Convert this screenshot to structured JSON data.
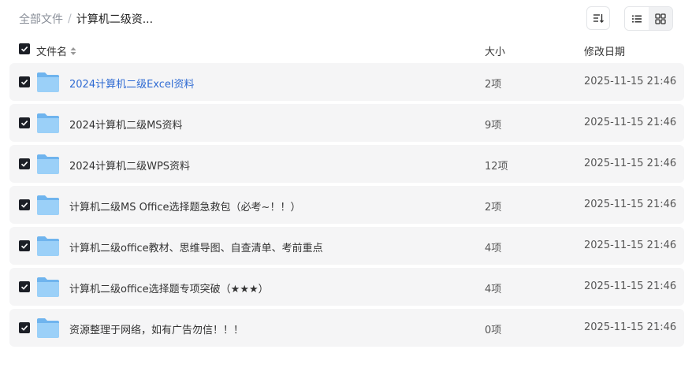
{
  "breadcrumb": {
    "root": "全部文件",
    "separator": "/",
    "current": "计算机二级资..."
  },
  "header": {
    "name": "文件名",
    "size": "大小",
    "date": "修改日期"
  },
  "icons": {
    "sort": "sort-icon",
    "list_view": "list-view-icon",
    "grid_view": "grid-view-icon",
    "folder": "folder-icon",
    "checkbox": "checked-checkbox-icon"
  },
  "colors": {
    "link": "#2f6bd3",
    "row_bg": "#f5f5f6",
    "checkbox": "#1c1f26",
    "folder": "#8cc8f6"
  },
  "files": [
    {
      "name": "2024计算机二级Excel资料",
      "size": "2项",
      "date": "2025-11-15 21:46"
    },
    {
      "name": "2024计算机二级MS资料",
      "size": "9项",
      "date": "2025-11-15 21:46"
    },
    {
      "name": "2024计算机二级WPS资料",
      "size": "12项",
      "date": "2025-11-15 21:46"
    },
    {
      "name": "计算机二级MS Office选择题急救包（必考~！！）",
      "size": "2项",
      "date": "2025-11-15 21:46"
    },
    {
      "name": "计算机二级office教材、思维导图、自查清单、考前重点",
      "size": "4项",
      "date": "2025-11-15 21:46"
    },
    {
      "name": "计算机二级office选择题专项突破（★★★）",
      "size": "4项",
      "date": "2025-11-15 21:46"
    },
    {
      "name": "资源整理于网络，如有广告勿信！！！",
      "size": "0项",
      "date": "2025-11-15 21:46"
    }
  ]
}
